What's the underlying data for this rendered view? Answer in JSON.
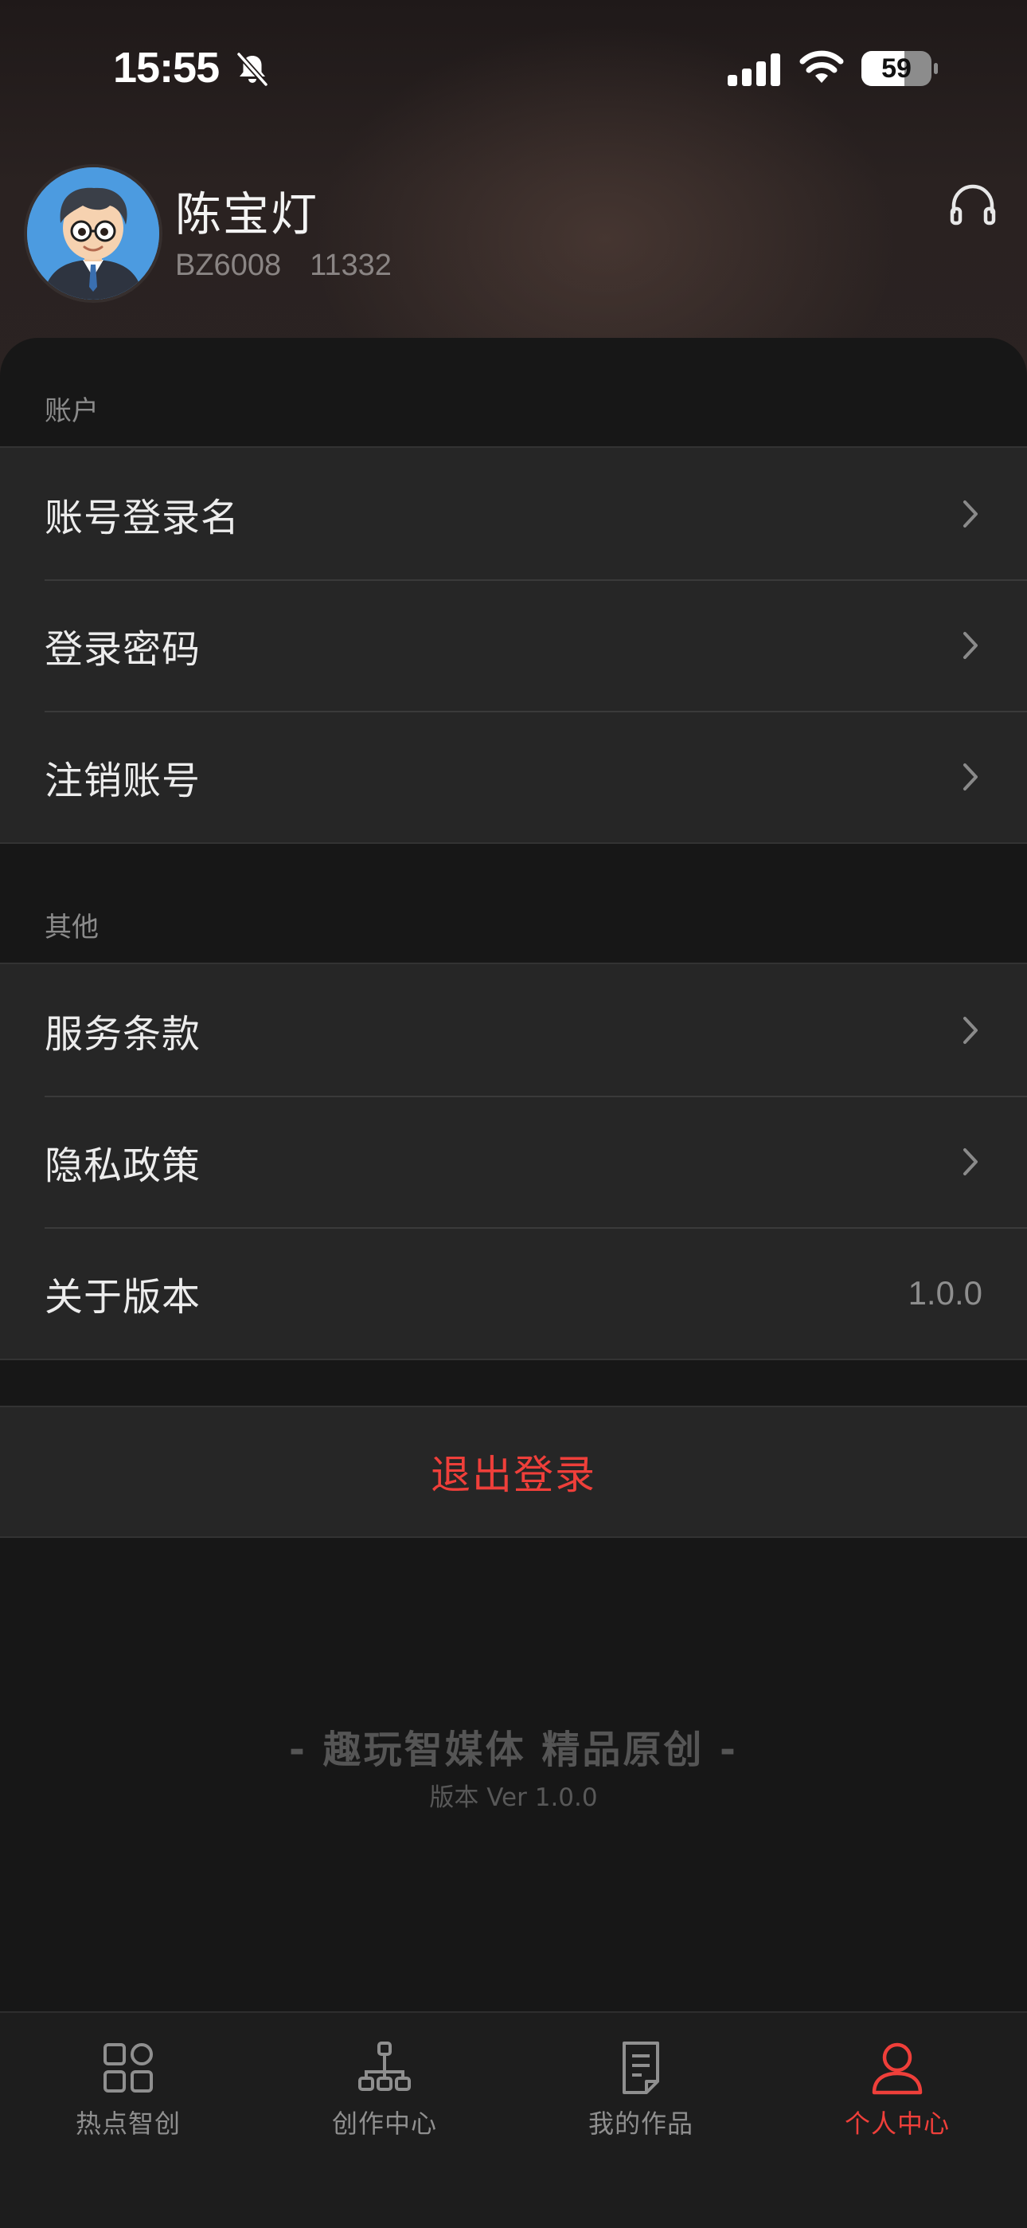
{
  "status_bar": {
    "time": "15:55",
    "battery": "59",
    "icons": [
      "bell-slash-icon",
      "cellular-signal-icon",
      "wifi-icon",
      "battery-icon"
    ]
  },
  "profile": {
    "name": "陈宝灯",
    "id_code": "BZ6008",
    "number": "11332",
    "avatar_icon": "cartoon-avatar",
    "support_icon": "headset-icon"
  },
  "account_section": {
    "title": "账户",
    "items": [
      {
        "label": "账号登录名"
      },
      {
        "label": "登录密码"
      },
      {
        "label": "注销账号"
      }
    ]
  },
  "other_section": {
    "title": "其他",
    "items": [
      {
        "label": "服务条款"
      },
      {
        "label": "隐私政策"
      },
      {
        "label": "关于版本",
        "value": "1.0.0"
      }
    ]
  },
  "logout_label": "退出登录",
  "footer": {
    "slogan": "- 趣玩智媒体 精品原创 -",
    "version": "版本 Ver 1.0.0"
  },
  "tabbar": {
    "items": [
      {
        "label": "热点智创",
        "icon": "grid-icon",
        "active": false
      },
      {
        "label": "创作中心",
        "icon": "hierarchy-icon",
        "active": false
      },
      {
        "label": "我的作品",
        "icon": "document-icon",
        "active": false
      },
      {
        "label": "个人中心",
        "icon": "person-icon",
        "active": true
      }
    ]
  },
  "colors": {
    "accent": "#ef3f3a",
    "background": "#171717",
    "row_background": "#262626"
  }
}
